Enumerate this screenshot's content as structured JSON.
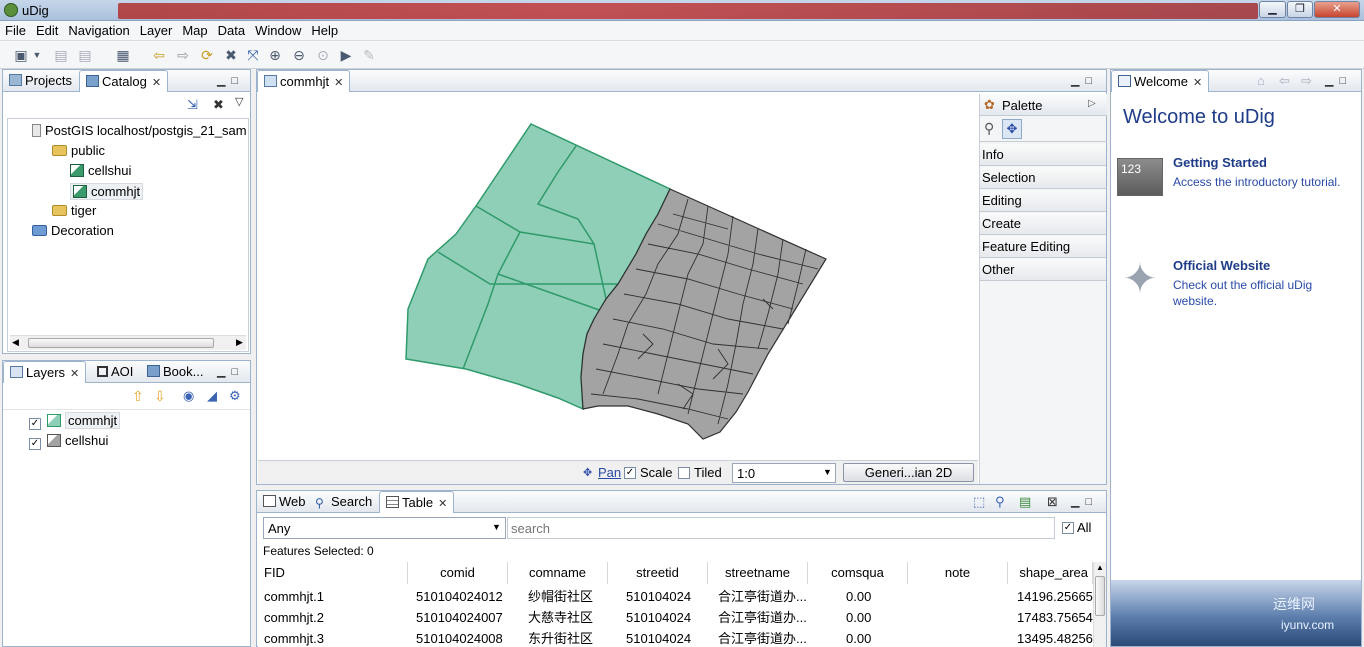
{
  "window": {
    "title": "uDig",
    "minimize": "▁",
    "maximize": "❐",
    "close": "✕"
  },
  "menu": [
    "File",
    "Edit",
    "Navigation",
    "Layer",
    "Map",
    "Data",
    "Window",
    "Help"
  ],
  "catalog": {
    "tabs": [
      "Projects",
      "Catalog"
    ],
    "tree": [
      {
        "label": "PostGIS localhost/postgis_21_sam",
        "type": "db"
      },
      {
        "label": "public",
        "type": "folder"
      },
      {
        "label": "cellshui",
        "type": "layer"
      },
      {
        "label": "commhjt",
        "type": "layer"
      },
      {
        "label": "tiger",
        "type": "folder"
      },
      {
        "label": "Decoration",
        "type": "folder"
      }
    ]
  },
  "layers": {
    "tabs": [
      "Layers",
      "AOI",
      "Book..."
    ],
    "items": [
      {
        "label": "commhjt",
        "checked": true
      },
      {
        "label": "cellshui",
        "checked": true
      }
    ]
  },
  "map": {
    "tab": "commhjt",
    "status": {
      "pan": "Pan",
      "scale": "Scale",
      "tiled": "Tiled",
      "scale_value": "1:0",
      "crs": "Generi...ian 2D"
    },
    "colors": {
      "green": "#8fcfb8",
      "green_stroke": "#2f9a6a",
      "gray": "#a3a3a3",
      "gray_stroke": "#303030"
    }
  },
  "palette": {
    "title": "Palette",
    "groups": [
      "Info",
      "Selection",
      "Editing",
      "Create",
      "Feature Editing",
      "Other"
    ]
  },
  "welcome": {
    "tab": "Welcome",
    "heading": "Welcome to uDig",
    "items": [
      {
        "title": "Getting Started",
        "desc": "Access the introductory tutorial."
      },
      {
        "title": "Official Website",
        "desc": "Check out the official uDig website."
      }
    ]
  },
  "bottom": {
    "tabs": [
      "Web",
      "Search",
      "Table"
    ],
    "filter": "Any",
    "search_placeholder": "search",
    "all_label": "All",
    "features_selected": "Features Selected: 0",
    "columns": [
      "FID",
      "comid",
      "comname",
      "streetid",
      "streetname",
      "comsqua",
      "note",
      "shape_area"
    ],
    "rows": [
      [
        "commhjt.1",
        "510104024012",
        "纱帽街社区",
        "510104024",
        "合江亭街道办...",
        "0.00",
        "",
        "14196.25665"
      ],
      [
        "commhjt.2",
        "510104024007",
        "大慈寺社区",
        "510104024",
        "合江亭街道办...",
        "0.00",
        "",
        "17483.75654"
      ],
      [
        "commhjt.3",
        "510104024008",
        "东升街社区",
        "510104024",
        "合江亭街道办...",
        "0.00",
        "",
        "13495.48256"
      ]
    ]
  },
  "watermark": {
    "text1": "运维网",
    "text2": "iyunv.com"
  }
}
